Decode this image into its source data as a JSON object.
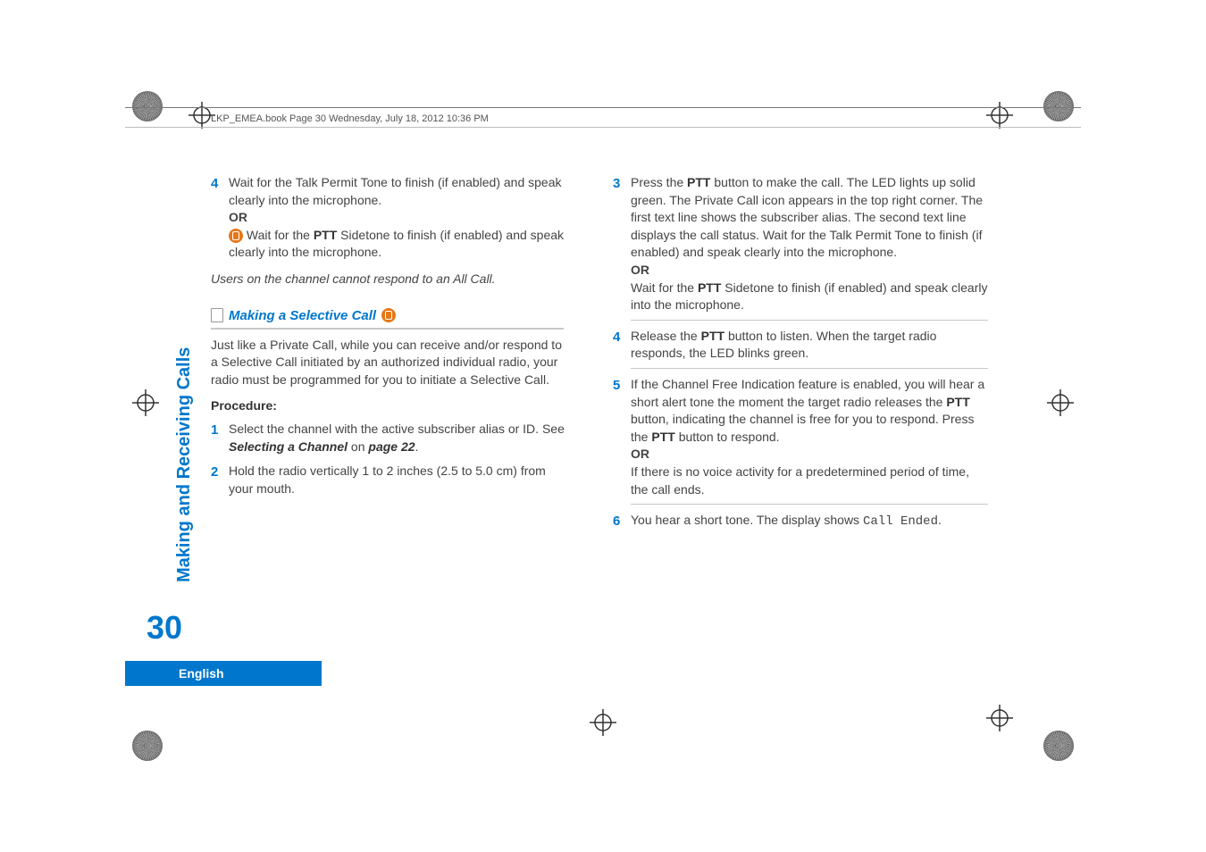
{
  "header": "LKP_EMEA.book  Page 30  Wednesday, July 18, 2012  10:36 PM",
  "left": {
    "step4_a": "Wait for the Talk Permit Tone to finish (if enabled) and speak clearly into the microphone.",
    "or": "OR",
    "step4_b_pre": " Wait for the ",
    "ptt": "PTT",
    "step4_b_post": " Sidetone to finish (if enabled) and speak clearly into the microphone.",
    "note": "Users on the channel cannot respond to an All Call.",
    "section_title": "Making a Selective Call",
    "intro": "Just like a Private Call, while you can receive and/or respond to a Selective Call initiated by an authorized individual radio, your radio must be programmed for you to initiate a Selective Call.",
    "procedure": "Procedure:",
    "s1_a": "Select the channel with the active subscriber alias or ID. See ",
    "s1_ref": "Selecting a Channel",
    "s1_on": " on ",
    "s1_page": "page 22",
    "s1_end": ".",
    "s2": "Hold the radio vertically 1 to 2 inches (2.5 to 5.0 cm) from your mouth."
  },
  "right": {
    "s3_a": "Press the ",
    "s3_b": " button to make the call. The LED lights up solid green. The Private Call icon appears in the top right corner. The first text line shows the subscriber alias. The second text line displays the call status. Wait for the Talk Permit Tone to finish (if enabled) and speak clearly into the microphone.",
    "or": "OR",
    "s3_c": "Wait for the ",
    "s3_d": " Sidetone to finish (if enabled) and speak clearly into the microphone.",
    "s4_a": "Release the ",
    "s4_b": " button to listen. When the target radio responds, the LED blinks green.",
    "s5_a": "If the Channel Free Indication feature is enabled, you will hear a short alert tone the moment the target radio releases the ",
    "s5_b": " button, indicating the channel is free for you to respond. Press the ",
    "s5_c": " button to respond.",
    "s5_or": "OR",
    "s5_d": "If there is no voice activity for a predetermined period of time, the call ends.",
    "s6_a": "You hear a short tone. The display shows ",
    "s6_code": "Call Ended",
    "s6_end": "."
  },
  "nums": {
    "n4": "4",
    "n1": "1",
    "n2": "2",
    "n3": "3",
    "n5": "5",
    "n6": "6"
  },
  "side_tab": "Making and Receiving Calls",
  "page_number": "30",
  "language": "English"
}
